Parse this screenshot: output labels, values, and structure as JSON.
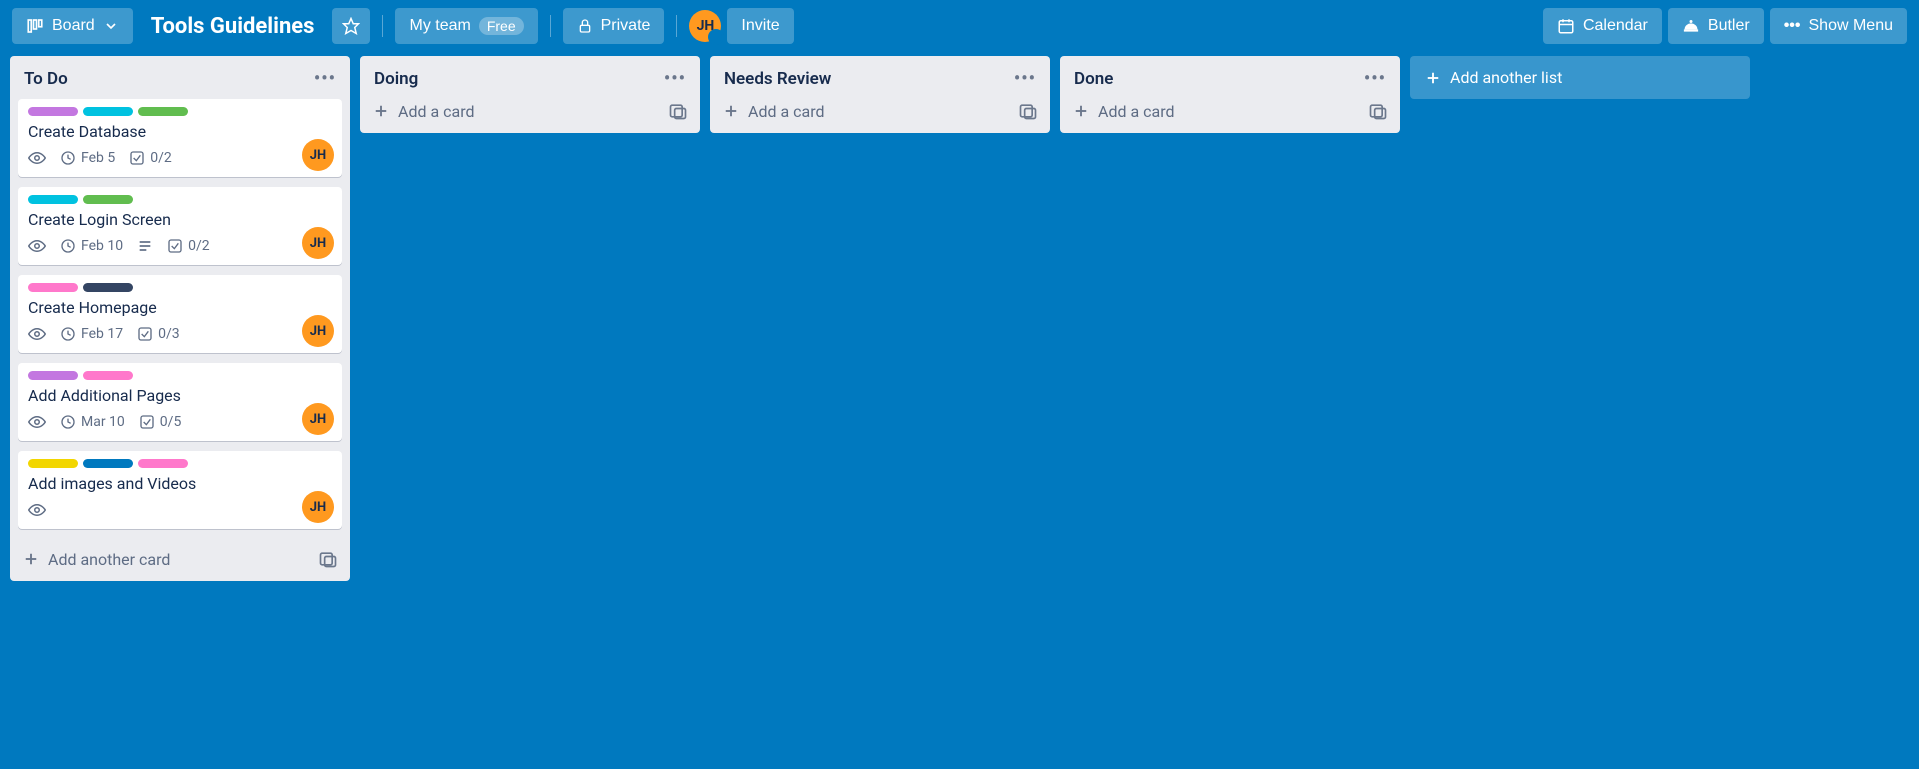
{
  "header": {
    "board_btn": "Board",
    "title": "Tools Guidelines",
    "team": "My team",
    "plan_pill": "Free",
    "visibility": "Private",
    "invite": "Invite",
    "calendar": "Calendar",
    "butler": "Butler",
    "show_menu": "Show Menu",
    "member_initials": "JH"
  },
  "add_list_label": "Add another list",
  "add_card_label": "Add a card",
  "add_another_card_label": "Add another card",
  "lists": [
    {
      "title": "To Do",
      "has_cards": true,
      "cards": [
        {
          "title": "Create Database",
          "labels": [
            "purple",
            "teal",
            "green"
          ],
          "date": "Feb 5",
          "checklist": "0/2",
          "desc": false,
          "member": "JH"
        },
        {
          "title": "Create Login Screen",
          "labels": [
            "teal",
            "green"
          ],
          "date": "Feb 10",
          "checklist": "0/2",
          "desc": true,
          "member": "JH"
        },
        {
          "title": "Create Homepage",
          "labels": [
            "pink",
            "navy"
          ],
          "date": "Feb 17",
          "checklist": "0/3",
          "desc": false,
          "member": "JH"
        },
        {
          "title": "Add Additional Pages",
          "labels": [
            "purple",
            "pink"
          ],
          "date": "Mar 10",
          "checklist": "0/5",
          "desc": false,
          "member": "JH"
        },
        {
          "title": "Add images and Videos",
          "labels": [
            "yellow",
            "blue",
            "pink"
          ],
          "date": "",
          "checklist": "",
          "desc": false,
          "member": "JH"
        }
      ]
    },
    {
      "title": "Doing",
      "has_cards": false,
      "cards": []
    },
    {
      "title": "Needs Review",
      "has_cards": false,
      "cards": []
    },
    {
      "title": "Done",
      "has_cards": false,
      "cards": []
    }
  ]
}
